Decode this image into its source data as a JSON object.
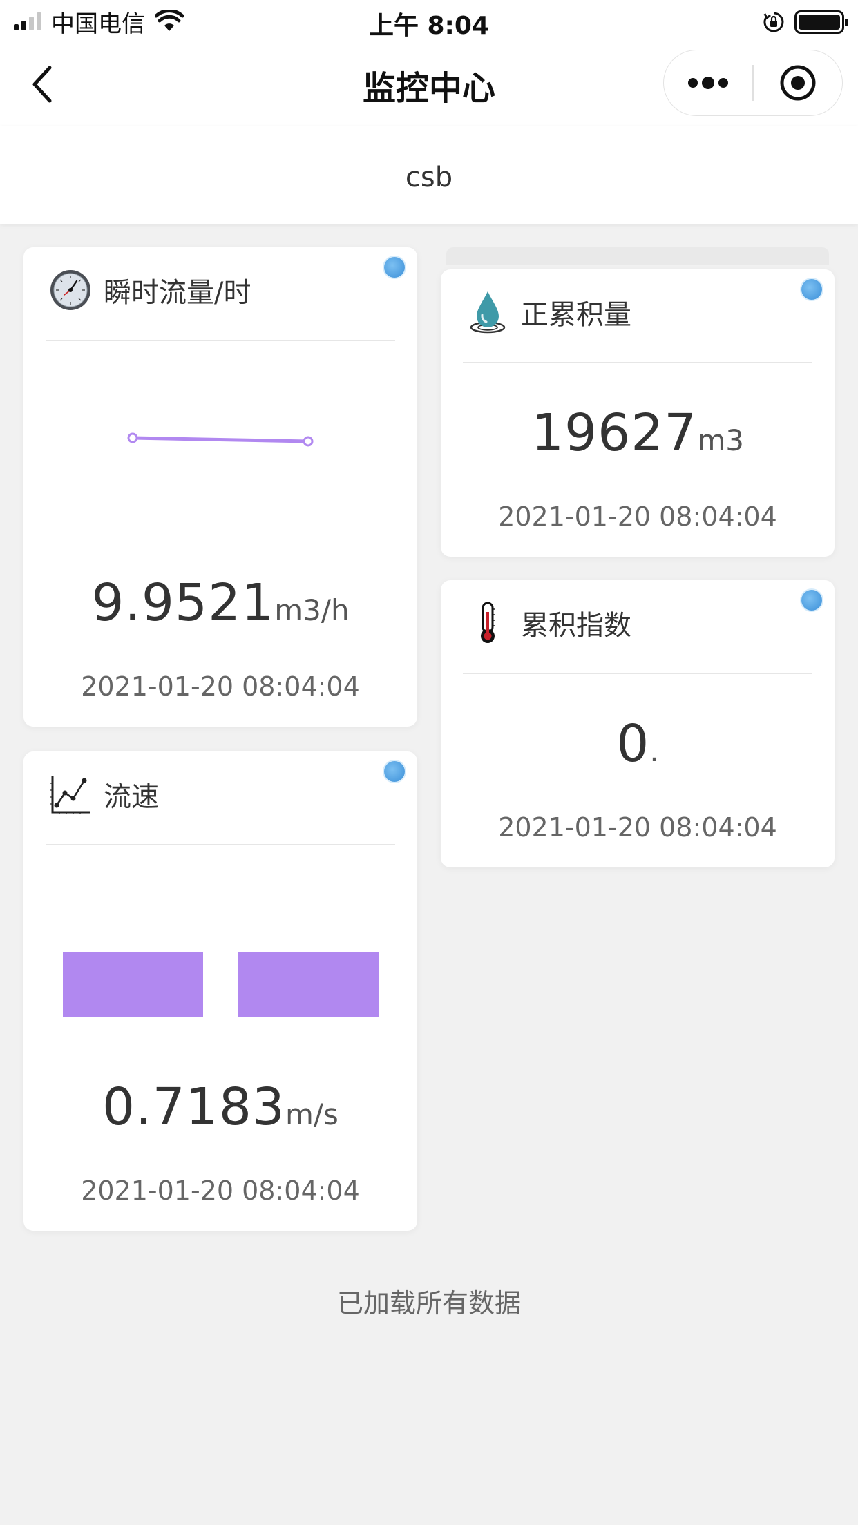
{
  "status_bar": {
    "carrier": "中国电信",
    "time": "上午 8:04"
  },
  "nav": {
    "title": "监控中心"
  },
  "device": {
    "name": "csb"
  },
  "cards": {
    "flow": {
      "title": "瞬时流量/时",
      "value": "9.9521",
      "unit": "m3/h",
      "time": "2021-01-20 08:04:04",
      "icon": "pressure-gauge-icon",
      "chart_color": "#b188f0"
    },
    "speed": {
      "title": "流速",
      "value": "0.7183",
      "unit": "m/s",
      "time": "2021-01-20 08:04:04",
      "icon": "line-chart-icon",
      "chart_color": "#b188f0"
    },
    "total": {
      "title": "正累积量",
      "value": "19627",
      "unit": "m3",
      "time": "2021-01-20 08:04:04",
      "icon": "water-drop-icon"
    },
    "index": {
      "title": "累积指数",
      "value": "0",
      "unit": ".",
      "time": "2021-01-20 08:04:04",
      "icon": "thermometer-icon"
    }
  },
  "footer": {
    "text": "已加载所有数据"
  },
  "colors": {
    "status_dot": "#4a9de0",
    "chart_accent": "#b188f0",
    "page_bg": "#f1f1f1"
  }
}
